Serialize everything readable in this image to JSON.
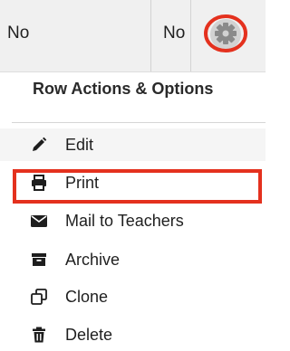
{
  "grid_row": {
    "cells": [
      "No",
      "No"
    ]
  },
  "gear_button": {
    "icon": "gear-icon",
    "annotation_color": "#e4311e"
  },
  "menu": {
    "title": "Row Actions & Options",
    "items": [
      {
        "label": "Edit",
        "icon": "pencil-icon"
      },
      {
        "label": "Print",
        "icon": "printer-icon"
      },
      {
        "label": "Mail to Teachers",
        "icon": "envelope-icon"
      },
      {
        "label": "Archive",
        "icon": "archive-box-icon"
      },
      {
        "label": "Clone",
        "icon": "clone-icon"
      },
      {
        "label": "Delete",
        "icon": "trash-icon"
      }
    ],
    "highlighted_item": "Archive",
    "highlight_color": "#e4311e"
  }
}
